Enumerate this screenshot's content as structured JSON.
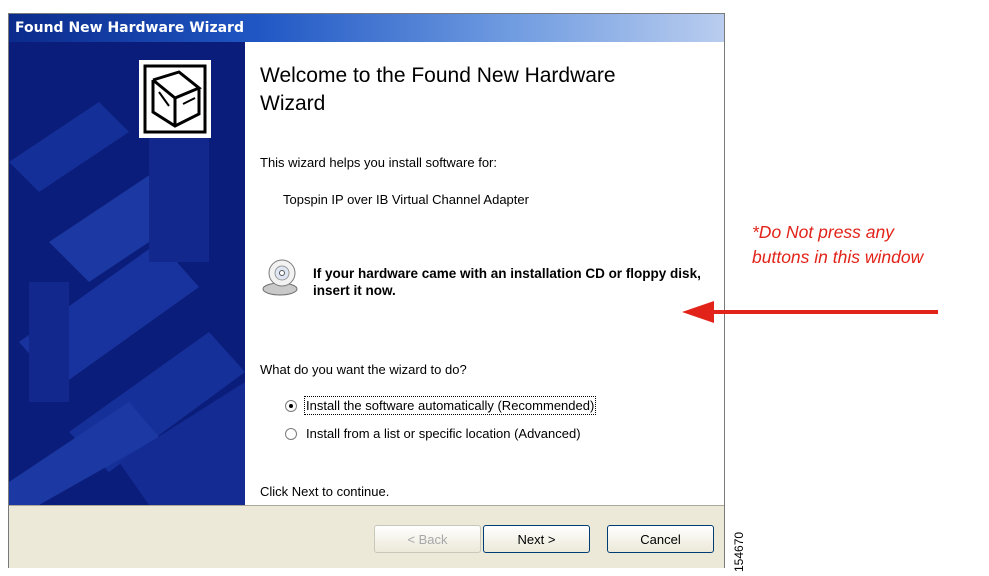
{
  "window": {
    "title": "Found New Hardware Wizard"
  },
  "content": {
    "heading": "Welcome to the Found New Hardware Wizard",
    "intro": "This wizard helps you install software for:",
    "device": "Topspin IP over IB Virtual Channel Adapter",
    "cd_prompt": "If your hardware came with an installation CD or floppy disk, insert it now.",
    "question": "What do you want the wizard to do?",
    "options": [
      {
        "label": "Install the software automatically (Recommended)",
        "selected": true
      },
      {
        "label": "Install from a list or specific location (Advanced)",
        "selected": false
      }
    ],
    "continue": "Click Next to continue."
  },
  "buttons": {
    "back": "< Back",
    "next": "Next >",
    "cancel": "Cancel"
  },
  "annotation": {
    "line1": "*Do Not press any",
    "line2": "buttons in this window",
    "color": "#e2231a"
  },
  "figure_id": "154670",
  "icons": [
    "hardware-box-icon",
    "cd-drive-icon",
    "arrow-left-icon"
  ]
}
